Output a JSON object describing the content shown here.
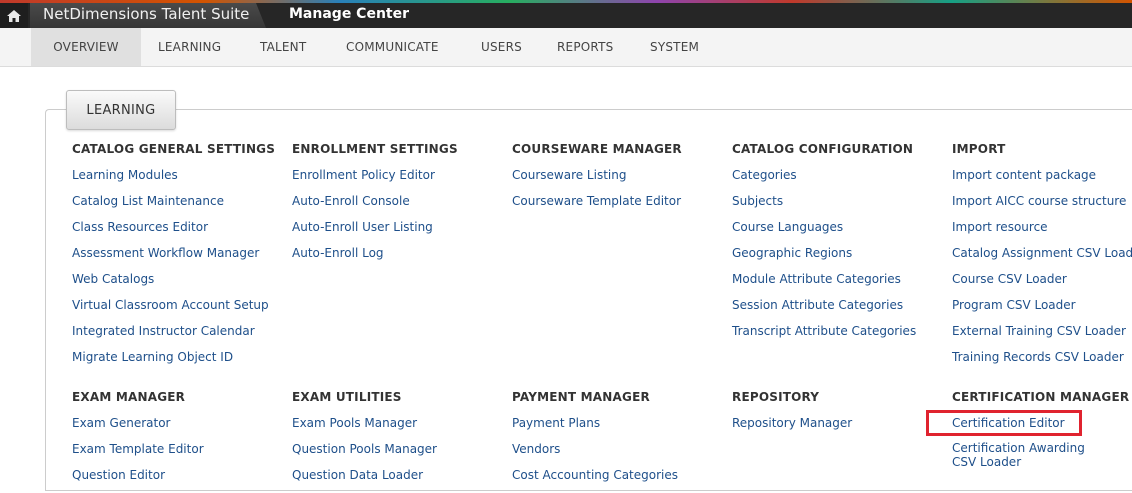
{
  "topbar": {
    "suite_title": "NetDimensions Talent Suite",
    "center_title": "Manage Center",
    "home_icon": "home-icon"
  },
  "nav": {
    "items": [
      "OVERVIEW",
      "LEARNING",
      "TALENT",
      "COMMUNICATE",
      "USERS",
      "REPORTS",
      "SYSTEM"
    ],
    "active": "OVERVIEW"
  },
  "panel": {
    "tab_label": "LEARNING",
    "sections": [
      {
        "title": "CATALOG GENERAL SETTINGS",
        "links": [
          "Learning Modules",
          "Catalog List Maintenance",
          "Class Resources Editor",
          "Assessment Workflow Manager",
          "Web Catalogs",
          "Virtual Classroom Account Setup",
          "Integrated Instructor Calendar",
          "Migrate Learning Object ID"
        ]
      },
      {
        "title": "ENROLLMENT SETTINGS",
        "links": [
          "Enrollment Policy Editor",
          "Auto-Enroll Console",
          "Auto-Enroll User Listing",
          "Auto-Enroll Log"
        ]
      },
      {
        "title": "COURSEWARE MANAGER",
        "links": [
          "Courseware Listing",
          "Courseware Template Editor"
        ]
      },
      {
        "title": "CATALOG CONFIGURATION",
        "links": [
          "Categories",
          "Subjects",
          "Course Languages",
          "Geographic Regions",
          "Module Attribute Categories",
          "Session Attribute Categories",
          "Transcript Attribute Categories"
        ]
      },
      {
        "title": "IMPORT",
        "links": [
          "Import content package",
          "Import AICC course structure",
          "Import resource",
          "Catalog Assignment CSV Loader",
          "Course CSV Loader",
          "Program CSV Loader",
          "External Training CSV Loader",
          "Training Records CSV Loader"
        ]
      },
      {
        "title": "EXAM MANAGER",
        "links": [
          "Exam Generator",
          "Exam Template Editor",
          "Question Editor"
        ]
      },
      {
        "title": "EXAM UTILITIES",
        "links": [
          "Exam Pools Manager",
          "Question Pools Manager",
          "Question Data Loader"
        ]
      },
      {
        "title": "PAYMENT MANAGER",
        "links": [
          "Payment Plans",
          "Vendors",
          "Cost Accounting Categories"
        ]
      },
      {
        "title": "REPOSITORY",
        "links": [
          "Repository Manager"
        ]
      },
      {
        "title": "CERTIFICATION MANAGER",
        "links": [
          "Certification Editor",
          "Certification Awarding CSV Loader"
        ]
      }
    ]
  },
  "colors": {
    "topbar_bg": "#262626",
    "link": "#1e4f8a",
    "highlight": "#e0232f"
  }
}
